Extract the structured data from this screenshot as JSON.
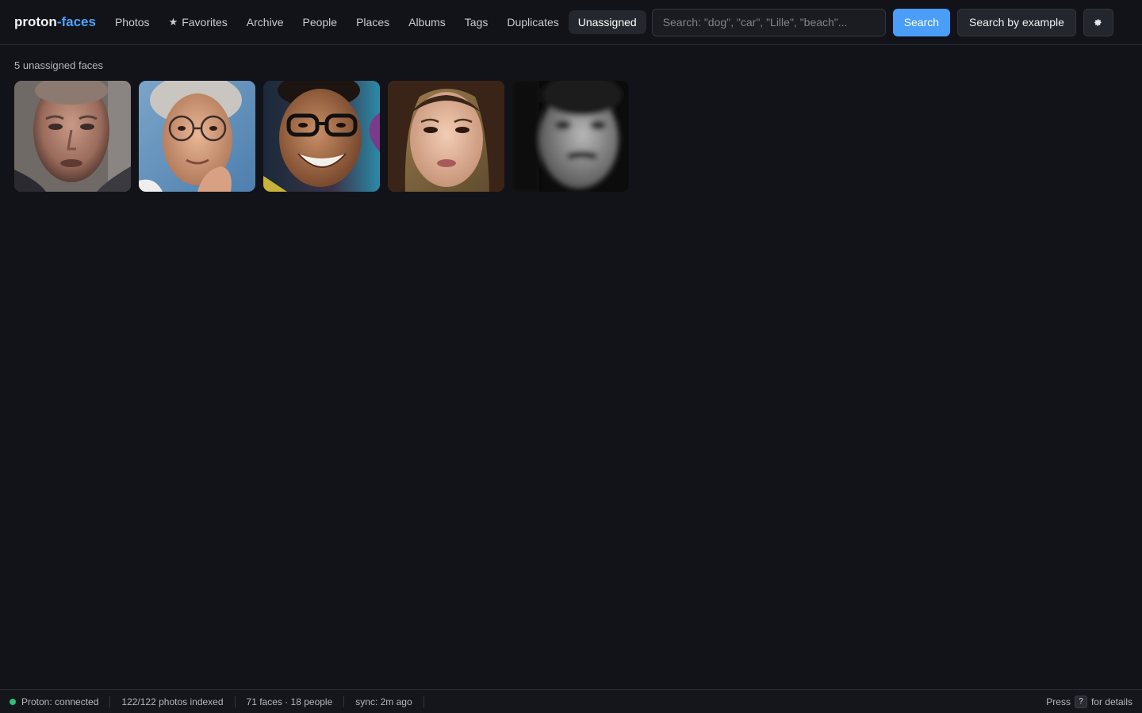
{
  "brand": {
    "name_main": "proton",
    "name_accent": "-faces"
  },
  "nav": {
    "items": [
      {
        "label": "Photos",
        "active": false
      },
      {
        "label": "Favorites",
        "active": false,
        "icon": "star-icon"
      },
      {
        "label": "Archive",
        "active": false
      },
      {
        "label": "People",
        "active": false
      },
      {
        "label": "Places",
        "active": false
      },
      {
        "label": "Albums",
        "active": false
      },
      {
        "label": "Tags",
        "active": false
      },
      {
        "label": "Duplicates",
        "active": false
      },
      {
        "label": "Unassigned",
        "active": true
      }
    ]
  },
  "search": {
    "placeholder": "Search: \"dog\", \"car\", \"Lille\", \"beach\"...",
    "value": "",
    "search_label": "Search",
    "example_label": "Search by example",
    "settings_icon": "gear-icon"
  },
  "main": {
    "count_label": "5 unassigned faces",
    "faces": [
      {
        "name": "face-1"
      },
      {
        "name": "face-2"
      },
      {
        "name": "face-3"
      },
      {
        "name": "face-4"
      },
      {
        "name": "face-5"
      }
    ]
  },
  "status": {
    "connection": "Proton: connected",
    "indexed": "122/122 photos indexed",
    "counts": "71 faces · 18 people",
    "sync": "sync: 2m ago",
    "help_prefix": "Press",
    "help_key": "?",
    "help_suffix": "for details"
  },
  "colors": {
    "accent": "#4da3ff",
    "primary_button": "#4a9ef8",
    "connected": "#2fbf71",
    "background": "#121318"
  }
}
